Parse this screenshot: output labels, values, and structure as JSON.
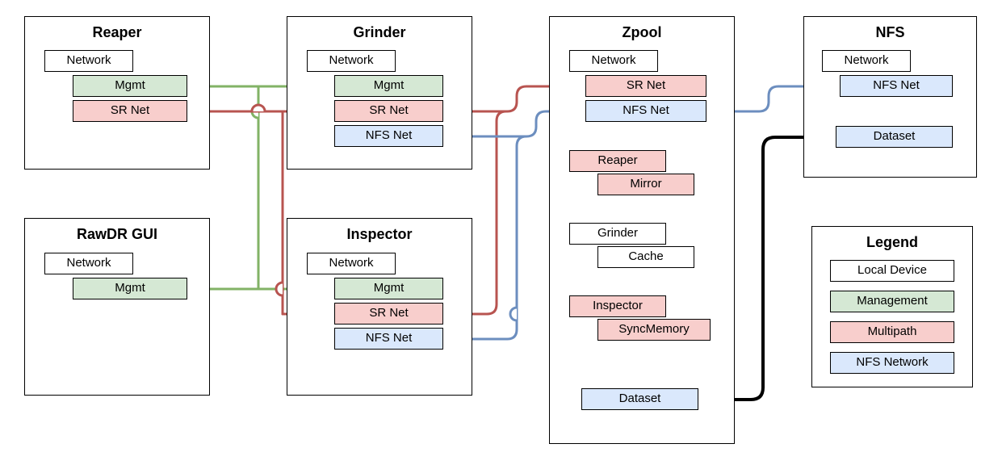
{
  "nodes": {
    "reaper": {
      "title": "Reaper",
      "network": "Network",
      "mgmt": "Mgmt",
      "sr": "SR Net"
    },
    "grinder": {
      "title": "Grinder",
      "network": "Network",
      "mgmt": "Mgmt",
      "sr": "SR Net",
      "nfs": "NFS Net"
    },
    "rawdr": {
      "title": "RawDR GUI",
      "network": "Network",
      "mgmt": "Mgmt"
    },
    "inspector": {
      "title": "Inspector",
      "network": "Network",
      "mgmt": "Mgmt",
      "sr": "SR Net",
      "nfs": "NFS Net"
    },
    "zpool": {
      "title": "Zpool",
      "network": "Network",
      "sr": "SR Net",
      "nfs": "NFS Net",
      "reaper": "Reaper",
      "mirror": "Mirror",
      "grinder": "Grinder",
      "cache": "Cache",
      "inspector": "Inspector",
      "syncmem": "SyncMemory",
      "dataset": "Dataset"
    },
    "nfs": {
      "title": "NFS",
      "network": "Network",
      "nfsnet": "NFS Net",
      "dataset": "Dataset"
    }
  },
  "legend": {
    "title": "Legend",
    "local": "Local Device",
    "mgmt": "Management",
    "multipath": "Multipath",
    "nfs": "NFS Network"
  },
  "chart_data": {
    "type": "diagram",
    "description": "Network topology showing Reaper, Grinder, RawDR GUI, Inspector, Zpool and NFS components interconnected by Management (green), Multipath/SR (red) and NFS (blue) networks, plus a data flow from Zpool Dataset to NFS Dataset.",
    "edges": [
      {
        "from": "reaper.mgmt",
        "to": "grinder.mgmt",
        "net": "management"
      },
      {
        "from": "rawdr.mgmt",
        "to": "inspector.mgmt",
        "net": "management"
      },
      {
        "from": "grinder.mgmt",
        "to": "inspector.mgmt",
        "net": "management"
      },
      {
        "from": "reaper.sr",
        "to": "grinder.sr",
        "net": "multipath"
      },
      {
        "from": "grinder.sr",
        "to": "inspector.sr",
        "net": "multipath"
      },
      {
        "from": "grinder.sr",
        "to": "zpool.sr",
        "net": "multipath"
      },
      {
        "from": "grinder.nfs",
        "to": "zpool.nfs",
        "net": "nfs"
      },
      {
        "from": "inspector.nfs",
        "to": "zpool.nfs",
        "net": "nfs"
      },
      {
        "from": "zpool.nfs",
        "to": "nfs.nfsnet",
        "net": "nfs"
      },
      {
        "from": "zpool.dataset",
        "to": "nfs.dataset",
        "net": "data",
        "arrow": true
      }
    ],
    "legend": {
      "white": "Local Device",
      "green": "Management",
      "red": "Multipath",
      "blue": "NFS Network"
    }
  }
}
